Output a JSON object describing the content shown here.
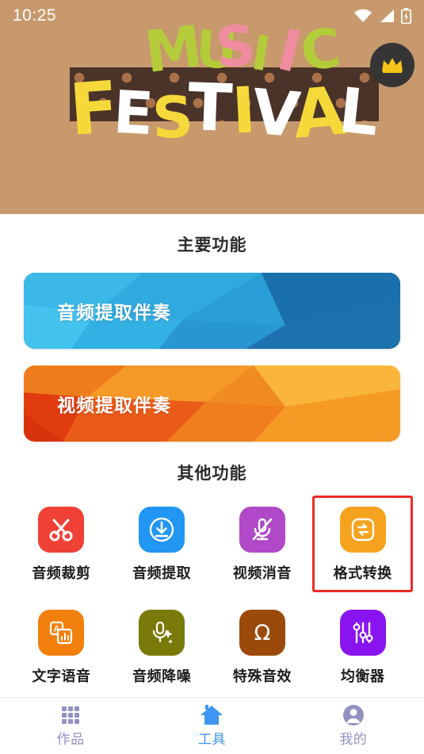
{
  "status_bar": {
    "time": "10:25",
    "icons": [
      "wifi-icon",
      "signal-icon",
      "battery-icon"
    ]
  },
  "banner": {
    "title_line1": "MUSIC",
    "title_line2": "FESTIVAL",
    "background_color": "#c7996c",
    "band_color": "#4a3328",
    "dot_color": "#a9714a",
    "letters_line1": [
      {
        "ch": "M",
        "color": "#b5cc3a"
      },
      {
        "ch": "U",
        "color": "#b5cc3a"
      },
      {
        "ch": "S",
        "color": "#f08ca0"
      },
      {
        "ch": "I",
        "color": "#b5cc3a"
      },
      {
        "ch": "C",
        "color": "#b5cc3a"
      }
    ],
    "letters_line2": [
      {
        "ch": "F",
        "color": "#f5d93a"
      },
      {
        "ch": "E",
        "color": "#ffffff"
      },
      {
        "ch": "S",
        "color": "#f5d93a"
      },
      {
        "ch": "T",
        "color": "#ffffff"
      },
      {
        "ch": "I",
        "color": "#f5d93a"
      },
      {
        "ch": "V",
        "color": "#ffffff"
      },
      {
        "ch": "A",
        "color": "#f5d93a"
      },
      {
        "ch": "L",
        "color": "#ffffff"
      }
    ],
    "vip_badge": {
      "icon": "crown-icon",
      "circle_color": "#353535",
      "crown_color": "#f5c518"
    }
  },
  "sections": {
    "main_title": "主要功能",
    "other_title": "其他功能"
  },
  "feature_cards": [
    {
      "label": "音频提取伴奏",
      "theme": "blue",
      "colors": [
        "#3cb8e8",
        "#2a9ed6",
        "#1e7ab8",
        "#1565a0",
        "#45c3ef"
      ]
    },
    {
      "label": "视频提取伴奏",
      "theme": "orange",
      "colors": [
        "#f6a324",
        "#f08b22",
        "#ea5b18",
        "#e03c10",
        "#f9b63a"
      ]
    }
  ],
  "other_functions": [
    {
      "label": "音频裁剪",
      "icon": "scissors-icon",
      "color": "#ef4136",
      "selected": false
    },
    {
      "label": "音频提取",
      "icon": "download-icon",
      "color": "#2196f3",
      "selected": false
    },
    {
      "label": "视频消音",
      "icon": "mic-muted-icon",
      "color": "#b048c8",
      "selected": false
    },
    {
      "label": "格式转换",
      "icon": "swap-icon",
      "color": "#f5a31e",
      "selected": true
    },
    {
      "label": "文字语音",
      "icon": "text-to-speech-icon",
      "color": "#f2800c",
      "selected": false
    },
    {
      "label": "音频降噪",
      "icon": "mic-sparkle-icon",
      "color": "#7a7a0a",
      "selected": false
    },
    {
      "label": "特殊音效",
      "icon": "omega-icon",
      "color": "#9c4a0c",
      "selected": false
    },
    {
      "label": "均衡器",
      "icon": "equalizer-icon",
      "color": "#8a14f0",
      "selected": false
    }
  ],
  "selection_highlight_color": "#ec2b26",
  "tabbar": {
    "items": [
      {
        "label": "作品",
        "icon": "grid-icon",
        "active": false
      },
      {
        "label": "工具",
        "icon": "home-icon",
        "active": true
      },
      {
        "label": "我的",
        "icon": "person-icon",
        "active": false
      }
    ],
    "active_color": "#3e96f0",
    "inactive_color": "#9292c2"
  }
}
